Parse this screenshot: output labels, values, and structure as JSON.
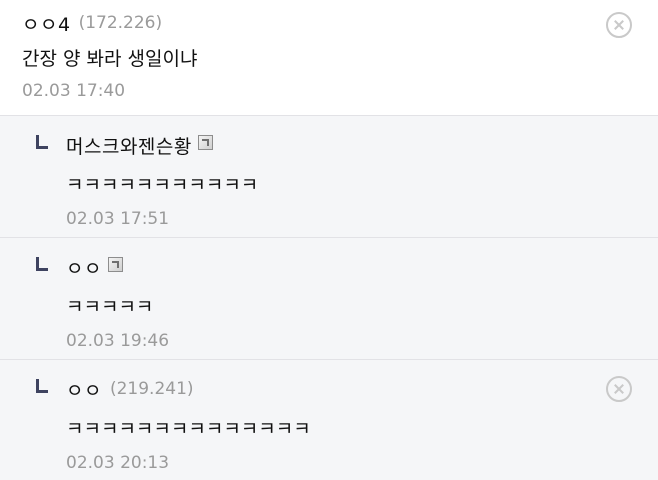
{
  "comments": [
    {
      "nick": "ㅇㅇ4",
      "ip": "(172.226)",
      "text": "간장 양 봐라 생일이냐",
      "date": "02.03 17:40",
      "has_badge": false,
      "has_delete": true
    },
    {
      "nick": "머스크와젠슨황",
      "ip": "",
      "text": "ㅋㅋㅋㅋㅋㅋㅋㅋㅋㅋㅋ",
      "date": "02.03 17:51",
      "has_badge": true,
      "has_delete": false
    },
    {
      "nick": "ㅇㅇ",
      "ip": "",
      "text": "ㅋㅋㅋㅋㅋ",
      "date": "02.03 19:46",
      "has_badge": true,
      "has_delete": false
    },
    {
      "nick": "ㅇㅇ",
      "ip": "(219.241)",
      "text": "ㅋㅋㅋㅋㅋㅋㅋㅋㅋㅋㅋㅋㅋㅋ",
      "date": "02.03 20:13",
      "has_badge": false,
      "has_delete": true
    }
  ],
  "icons": {
    "reply": "reply-arrow-icon",
    "badge": "fixed-nick-badge-icon",
    "delete": "close-circle-icon"
  },
  "colors": {
    "reply_background": "#f5f6f8",
    "meta_text": "#9a9a9a",
    "reply_mark": "#3e4360"
  }
}
